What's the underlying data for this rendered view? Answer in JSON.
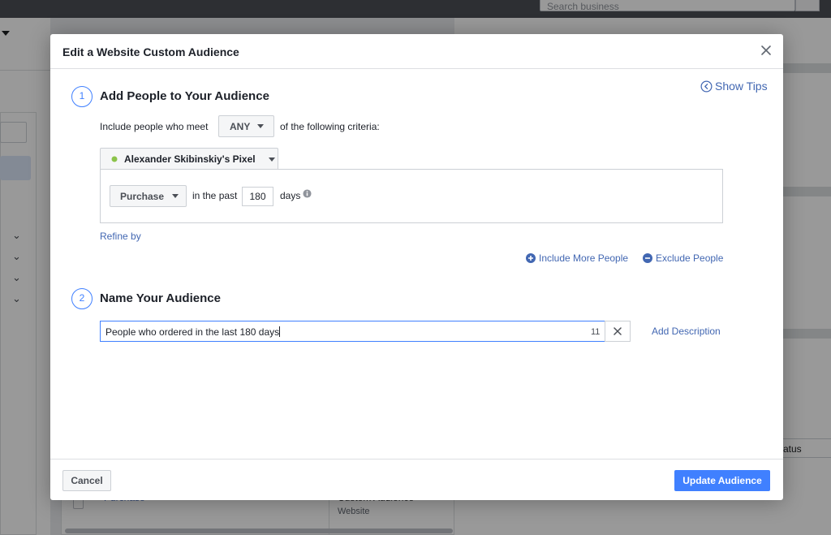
{
  "background": {
    "search_placeholder": "Search business",
    "status_header": "atus",
    "row_link": "Purchase",
    "row_type": "Custom Audience",
    "row_subtype": "Website"
  },
  "modal": {
    "title": "Edit a Website Custom Audience",
    "show_tips": "Show Tips",
    "step1": {
      "number": "1",
      "title": "Add People to Your Audience",
      "include_prefix": "Include people who meet",
      "match_value": "ANY",
      "include_suffix": "of the following criteria:",
      "pixel_name": "Alexander Skibinskiy's Pixel",
      "pixel_status_color": "#8bc34a",
      "event_value": "Purchase",
      "in_the_past": "in the past",
      "days_value": "180",
      "days_label": "days",
      "refine_by": "Refine by",
      "include_more": "Include More People",
      "exclude": "Exclude People"
    },
    "step2": {
      "number": "2",
      "title": "Name Your Audience",
      "name_value": "People who ordered in the last 180 days",
      "char_count": "11",
      "add_description": "Add Description"
    },
    "footer": {
      "cancel": "Cancel",
      "update": "Update Audience"
    }
  },
  "colors": {
    "accent": "#4080ff",
    "link": "#4267b2"
  }
}
